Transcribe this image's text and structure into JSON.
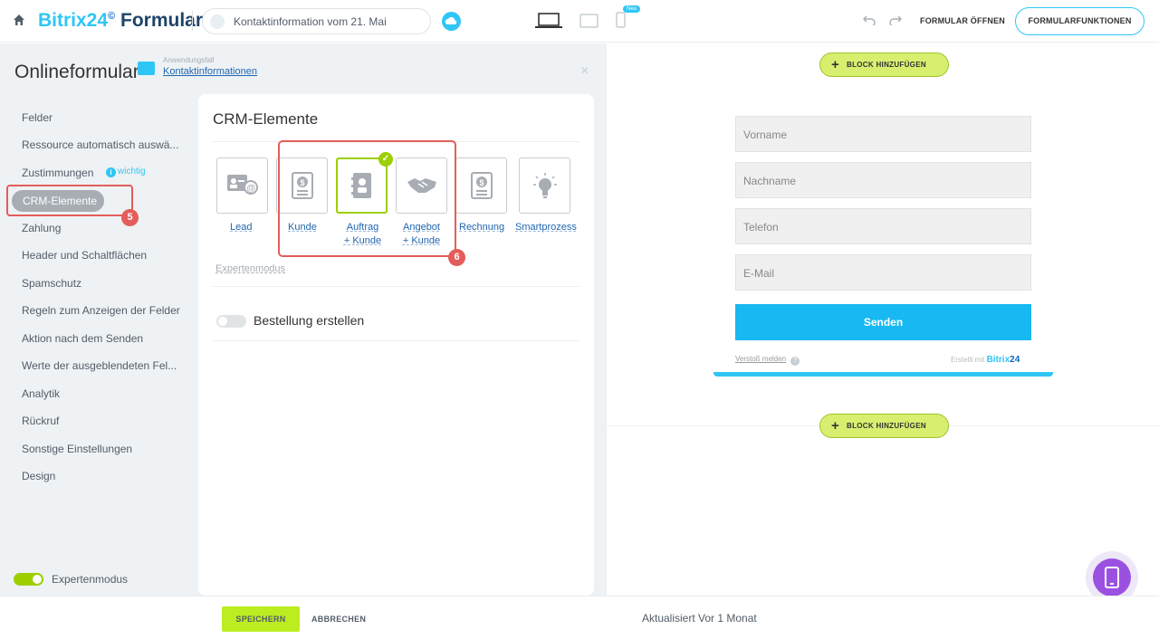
{
  "topbar": {
    "brand_part1": "Bitrix24",
    "brand_sign": "©",
    "brand_part2": "Formulare",
    "form_title": "Kontaktinformation vom 21. Mai",
    "new_badge": "Neu",
    "open_form": "FORMULAR ÖFFNEN",
    "form_functions": "FORMULARFUNKTIONEN"
  },
  "panel": {
    "title": "Onlineformular",
    "usecase_label": "Anwendungsfall",
    "usecase_value": "Kontaktinformationen",
    "close": "×"
  },
  "nav": {
    "items": [
      "Felder",
      "Ressource automatisch auswä...",
      "Zustimmungen",
      "CRM-Elemente",
      "Zahlung",
      "Header und Schaltflächen",
      "Spamschutz",
      "Regeln zum Anzeigen der Felder",
      "Aktion nach dem Senden",
      "Werte der ausgeblendeten Fel...",
      "Analytik",
      "Rückruf",
      "Sonstige Einstellungen",
      "Design"
    ],
    "wichtig": "wichtig",
    "wichtig_icon": "i"
  },
  "annotations": {
    "badge5": "5",
    "badge6": "6"
  },
  "crm": {
    "title": "CRM-Elemente",
    "lead": "Lead",
    "kunde": "Kunde",
    "auftrag_1": "Auftrag",
    "auftrag_2": "+ Kunde",
    "angebot_1": "Angebot",
    "angebot_2": "+ Kunde",
    "rechnung": "Rechnung",
    "smartprozess": "Smartprozess",
    "check": "✓",
    "expertmodus": "Expertenmodus",
    "order_toggle": "Bestellung erstellen"
  },
  "footer_left": {
    "expert_mode": "Expertenmodus"
  },
  "bottom": {
    "save": "SPEICHERN",
    "cancel": "ABBRECHEN",
    "updated": "Aktualisiert Vor 1 Monat"
  },
  "preview": {
    "add_block": "BLOCK HINZUFÜGEN",
    "plus": "+",
    "fields": [
      "Vorname",
      "Nachname",
      "Telefon",
      "E-Mail"
    ],
    "send": "Senden",
    "report": "Verstoß melden",
    "report_q": "?",
    "made_with": "Erstellt mit",
    "made_with_b1": "Bitrix",
    "made_with_b2": "24"
  },
  "colors": {
    "accent": "#2fc6f6",
    "green": "#9dcf00",
    "highlight": "#e35d5b",
    "send": "#18b9f2"
  }
}
